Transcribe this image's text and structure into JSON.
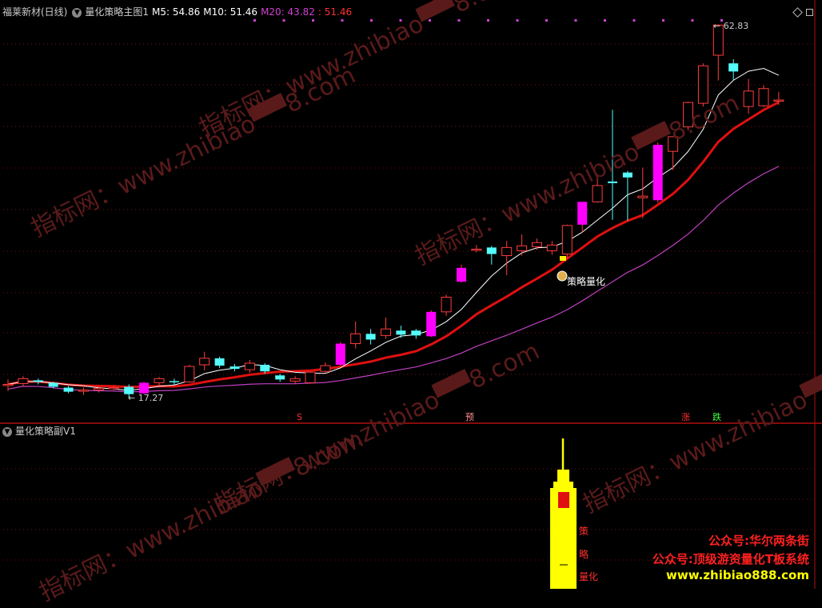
{
  "header": {
    "stock": "福莱新材(日线)",
    "indicator": "量化策略主图1",
    "m5": "M5: 54.86",
    "m10": "M10: 51.46",
    "m20_label": "M20: 43.82",
    "m20_extra": ": 51.46"
  },
  "sub_panel": {
    "title": "量化策略副V1"
  },
  "annotations": {
    "high_label": "62.83",
    "low_label": "17.27",
    "strategy_label": "策略量化",
    "signals": [
      {
        "text": "S",
        "color": "#ff3030"
      },
      {
        "text": "预",
        "color": "#ff9090"
      },
      {
        "text": "涨",
        "color": "#ff3030"
      },
      {
        "text": "跌",
        "color": "#40ff40"
      }
    ],
    "sub_vertical": [
      "策",
      "略",
      "量化"
    ]
  },
  "watermarks": [
    "指标网：www.zhibiao▀▀8.com",
    "指标网：www.zhibiao▀▀8.com",
    "指标网：www.zhibiao▀▀8.com",
    "指标网：www.zhibiao▀▀8.com",
    "指标网：www.zhibiao▀▀8.com",
    "指标网：www.zhibiao▀▀8.com"
  ],
  "promo": {
    "line1": "公众号:华尔两条街",
    "line2": "公众号:顶级游资量化T板系统",
    "line3": "www.zhibiao888.com"
  },
  "colors": {
    "up": "#ff3c3c",
    "down": "#54fcfc",
    "signal": "#ff00ff",
    "ma5": "#ffffff",
    "ma10": "#e01010",
    "ma20": "#c040c0",
    "m20_text": "#d040d0",
    "promo_red": "#ff2020",
    "promo_yellow": "#ffff00",
    "tower": "#ffff00"
  },
  "chart_data": {
    "type": "candlestick",
    "series": [
      {
        "name": "K",
        "ohlc": [
          [
            18.5,
            19.2,
            17.8,
            18.6
          ],
          [
            18.7,
            19.6,
            18.3,
            19.3
          ],
          [
            19.1,
            19.3,
            18.6,
            18.9
          ],
          [
            18.8,
            18.9,
            18.1,
            18.3
          ],
          [
            18.2,
            18.4,
            17.5,
            17.7
          ],
          [
            17.8,
            18.2,
            17.3,
            17.9
          ],
          [
            17.9,
            18.4,
            17.6,
            18.1
          ],
          [
            18.1,
            18.4,
            17.9,
            18.2
          ],
          [
            18.3,
            18.6,
            17.0,
            17.4
          ],
          [
            17.5,
            18.9,
            17.4,
            18.8
          ],
          [
            18.8,
            19.5,
            18.5,
            19.3
          ],
          [
            19.0,
            19.3,
            18.5,
            18.9
          ],
          [
            18.9,
            21.0,
            18.8,
            20.8
          ],
          [
            21.0,
            22.6,
            20.3,
            21.8
          ],
          [
            21.8,
            22.0,
            20.6,
            20.9
          ],
          [
            20.8,
            21.1,
            20.2,
            20.5
          ],
          [
            20.4,
            21.6,
            20.0,
            21.2
          ],
          [
            21.0,
            21.2,
            19.9,
            20.2
          ],
          [
            19.7,
            19.9,
            18.9,
            19.2
          ],
          [
            19.0,
            19.6,
            18.7,
            19.3
          ],
          [
            18.8,
            20.2,
            18.7,
            20.1
          ],
          [
            20.2,
            21.3,
            20.0,
            20.9
          ],
          [
            21.0,
            23.8,
            20.9,
            23.6
          ],
          [
            23.6,
            26.3,
            23.0,
            24.8
          ],
          [
            24.8,
            25.4,
            23.5,
            24.1
          ],
          [
            24.6,
            26.8,
            24.2,
            25.4
          ],
          [
            25.2,
            25.8,
            24.3,
            24.7
          ],
          [
            25.2,
            25.4,
            24.2,
            24.6
          ],
          [
            24.5,
            27.7,
            24.4,
            27.5
          ],
          [
            27.5,
            29.6,
            27.0,
            29.3
          ],
          [
            31.2,
            33.3,
            31.1,
            32.9
          ],
          [
            35.1,
            35.7,
            34.8,
            35.2
          ],
          [
            35.4,
            35.6,
            33.3,
            34.6
          ],
          [
            34.4,
            36.2,
            32.0,
            35.4
          ],
          [
            35.0,
            37.0,
            34.4,
            35.6
          ],
          [
            35.5,
            36.5,
            35.1,
            36.0
          ],
          [
            35.0,
            36.2,
            34.5,
            35.7
          ],
          [
            34.6,
            38.2,
            34.0,
            38.1
          ],
          [
            38.2,
            40.9,
            37.2,
            41.0
          ],
          [
            41.0,
            44.0,
            40.9,
            43.0
          ],
          [
            43.5,
            52.3,
            38.8,
            43.3
          ],
          [
            44.6,
            44.8,
            38.7,
            44.0
          ],
          [
            41.5,
            45.2,
            39.0,
            41.7
          ],
          [
            41.2,
            48.3,
            40.9,
            48.0
          ],
          [
            47.2,
            49.0,
            44.9,
            49.0
          ],
          [
            50.2,
            53.3,
            49.8,
            53.2
          ],
          [
            53.1,
            58.0,
            52.7,
            57.7
          ],
          [
            59.0,
            62.8,
            55.9,
            62.7
          ],
          [
            58.0,
            58.5,
            55.9,
            57.0
          ],
          [
            52.7,
            56.1,
            51.8,
            54.6
          ],
          [
            52.8,
            55.3,
            52.6,
            54.9
          ],
          [
            53.5,
            54.5,
            52.9,
            53.5
          ]
        ]
      }
    ],
    "ma": {
      "M5": 54.86,
      "M10": 51.46,
      "M20": 43.82
    },
    "high": 62.83,
    "low": 17.27,
    "ylim": [
      16.5,
      64.5
    ]
  }
}
